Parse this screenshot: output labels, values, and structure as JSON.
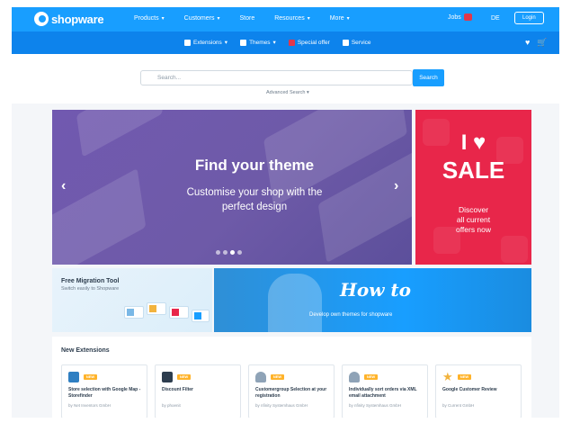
{
  "header": {
    "logo_text": "shopware",
    "nav": [
      "Products",
      "Customers",
      "Store",
      "Resources",
      "More"
    ],
    "lang_label": "Jobs",
    "lang_code": "DE",
    "login_label": "Login"
  },
  "subnav": {
    "items": [
      "Extensions",
      "Themes",
      "Special offer",
      "Service"
    ]
  },
  "search": {
    "placeholder": "Search...",
    "button_label": "Search",
    "advanced_label": "Advanced Search ▾"
  },
  "slider": {
    "title": "Find your theme",
    "subtitle_line1": "Customise your shop with the",
    "subtitle_line2": "perfect design",
    "slide_count": 4,
    "active_slide": 3
  },
  "sale": {
    "line1": "I ♥",
    "line2": "SALE",
    "text_line1": "Discover",
    "text_line2": "all current",
    "text_line3": "offers now"
  },
  "migration": {
    "title": "Free Migration Tool",
    "subtitle": "Switch easily to Shopware"
  },
  "howto": {
    "title": "How to",
    "subtitle": "Develop own themes for shopware"
  },
  "extensions": {
    "heading": "New Extensions",
    "badge_label": "NEW",
    "cards": [
      {
        "name": "Store selection with Google Map - Storefinder",
        "by": "by Net Inventors GmbH",
        "icon": "store-map-icon"
      },
      {
        "name": "Discount Filter",
        "by": "by phoenit",
        "icon": "filter-icon"
      },
      {
        "name": "Customergroup Selection at your registration",
        "by": "by nfinity Systemhaus GmbH",
        "icon": "customer-group-icon"
      },
      {
        "name": "Individually sort orders via XML email attachment",
        "by": "by nfinity Systemhaus GmbH",
        "icon": "xml-sort-icon"
      },
      {
        "name": "Google Customer Review",
        "by": "by Current GmbH",
        "icon": "star-icon"
      }
    ]
  },
  "colors": {
    "brand_blue": "#189eff",
    "sub_blue": "#0d83ec",
    "theme_purple": "#6e5aa8",
    "sale_red": "#e8264a",
    "badge_orange": "#ffb32a"
  }
}
